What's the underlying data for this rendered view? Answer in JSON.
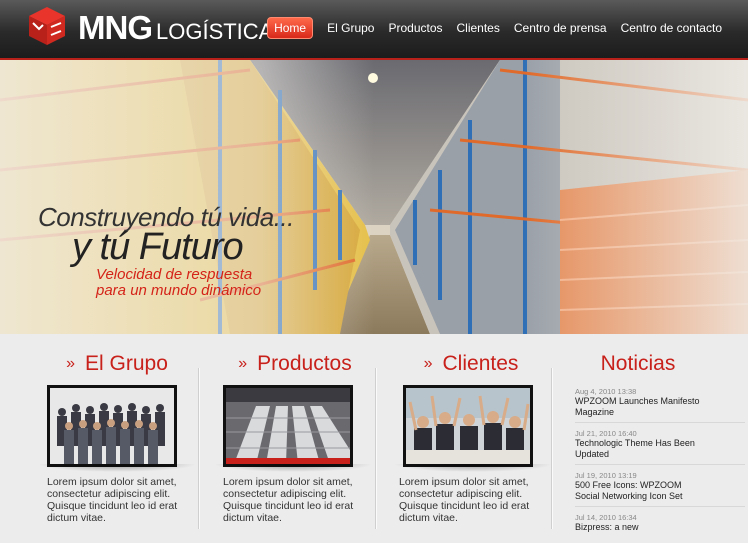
{
  "header": {
    "logo_main": "MNG",
    "logo_sub": "LOGÍSTICA",
    "nav": [
      "Home",
      "El Grupo",
      "Productos",
      "Clientes",
      "Centro de prensa",
      "Centro de contacto"
    ]
  },
  "banner": {
    "line1": "Construyendo tú vida...",
    "line2": "y tú Futuro",
    "line3": "Velocidad de respuesta",
    "line4": "para un mundo dinámico"
  },
  "columns": [
    {
      "arrows": "»",
      "title": "El Grupo",
      "text": "Lorem ipsum dolor sit amet, consectetur adipiscing elit. Quisque tincidunt leo id erat dictum vitae."
    },
    {
      "arrows": "»",
      "title": "Productos",
      "text": "Lorem ipsum dolor sit amet, consectetur adipiscing elit. Quisque tincidunt leo id erat dictum vitae."
    },
    {
      "arrows": "»",
      "title": "Clientes",
      "text": "Lorem ipsum dolor sit amet, consectetur adipiscing elit. Quisque tincidunt leo id erat dictum vitae."
    }
  ],
  "news": {
    "title": "Noticias",
    "items": [
      {
        "date": "Aug 4, 2010 13:38",
        "title": "WPZOOM Launches Manifesto Magazine"
      },
      {
        "date": "Jul 21, 2010 16:40",
        "title": "Technologic Theme Has Been Updated"
      },
      {
        "date": "Jul 19, 2010 13:19",
        "title": "500 Free Icons: WPZOOM Social Networking Icon Set"
      },
      {
        "date": "Jul 14, 2010 16:34",
        "title": "Bizpress: a new"
      }
    ]
  },
  "colors": {
    "accent": "#c8201a",
    "header_bg": "#2a2a2a",
    "page_bg": "#ececec"
  }
}
